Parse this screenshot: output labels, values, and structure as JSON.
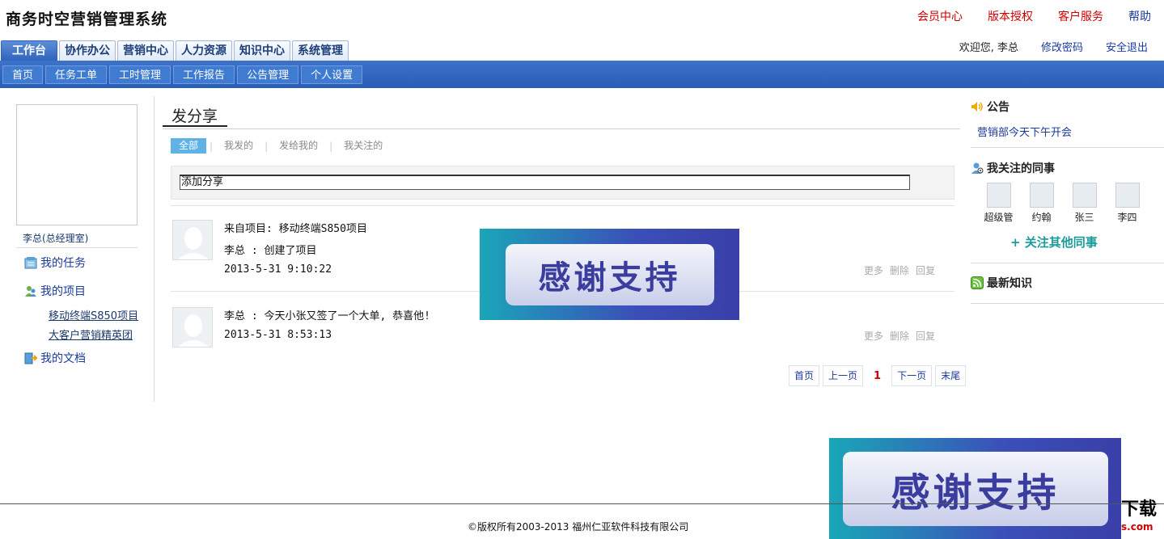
{
  "header": {
    "title": "商务时空营销管理系统",
    "links": [
      "会员中心",
      "版本授权",
      "客户服务",
      "帮助"
    ],
    "welcome": "欢迎您, 李总",
    "change_password": "修改密码",
    "logout": "安全退出"
  },
  "main_tabs": [
    "工作台",
    "协作办公",
    "营销中心",
    "人力资源",
    "知识中心",
    "系统管理"
  ],
  "sub_nav": [
    "首页",
    "任务工单",
    "工时管理",
    "工作报告",
    "公告管理",
    "个人设置"
  ],
  "left": {
    "user_name": "李总(总经理室)",
    "menu": {
      "tasks": "我的任务",
      "projects": "我的项目",
      "docs": "我的文档"
    },
    "project_links": [
      "移动终端S850项目",
      "大客户营销精英团"
    ]
  },
  "center": {
    "title": "发分享",
    "filters": [
      "全部",
      "我发的",
      "发给我的",
      "我关注的"
    ],
    "compose_value": "添加分享",
    "posts": [
      {
        "line1": "来自项目: 移动终端S850项目",
        "line2": "李总 :  创建了项目",
        "time": "2013-5-31 9:10:22",
        "actions": [
          "更多",
          "删除",
          "回复"
        ]
      },
      {
        "line1": "李总 :  今天小张又签了一个大单, 恭喜他!",
        "time": "2013-5-31 8:53:13",
        "actions": [
          "更多",
          "删除",
          "回复"
        ]
      }
    ],
    "pager": {
      "first": "首页",
      "prev": "上一页",
      "current": "1",
      "next": "下一页",
      "last": "末尾"
    }
  },
  "right": {
    "notice_title": "公告",
    "notice_item": "营销部今天下午开会",
    "colleagues_title": "我关注的同事",
    "colleagues": [
      "超级管",
      "约翰",
      "张三",
      "李四"
    ],
    "follow_more": "+ 关注其他同事",
    "knowledge_title": "最新知识"
  },
  "overlay": {
    "badge_text": "感谢支持"
  },
  "footer": {
    "copyright": "©版权所有2003-2013 福州仁亚软件科技有限公司",
    "watermark_top": "下载",
    "watermark_bottom": "s.com"
  }
}
